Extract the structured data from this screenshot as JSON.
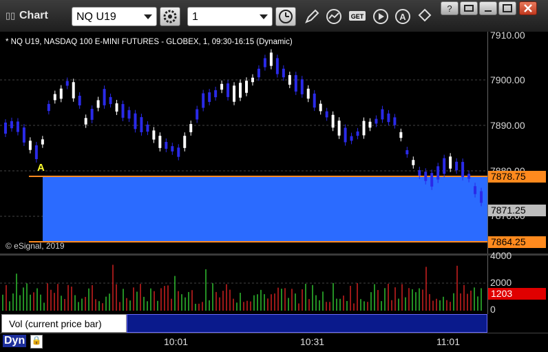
{
  "window": {
    "title": "Chart",
    "symbol": "NQ U19",
    "interval": "1"
  },
  "chart": {
    "description": "* NQ U19, NASDAQ 100 E-MINI FUTURES - GLOBEX, 1, 09:30-16:15 (Dynamic)",
    "copyright": "© eSignal, 2019",
    "marker_label": "A",
    "price_ticks": [
      "7910.00",
      "7900.00",
      "7890.00",
      "7880.00",
      "7870.00"
    ],
    "tags": {
      "upper": "7878.75",
      "last": "7871.25",
      "lower": "7864.25"
    },
    "colors": {
      "up_bar": "#ffffff",
      "down_bar": "#2a2ae8",
      "range_fill": "#2b6bff",
      "range_line": "#ff8a1e"
    }
  },
  "volume": {
    "label": "Vol (current price bar)",
    "close_glyph": "×",
    "ticks": [
      "4000",
      "2000",
      "0"
    ],
    "last_tag": "1203"
  },
  "time_axis": {
    "pane_label": "Dyn",
    "labels": [
      "10:01",
      "10:31",
      "11:01"
    ]
  }
}
